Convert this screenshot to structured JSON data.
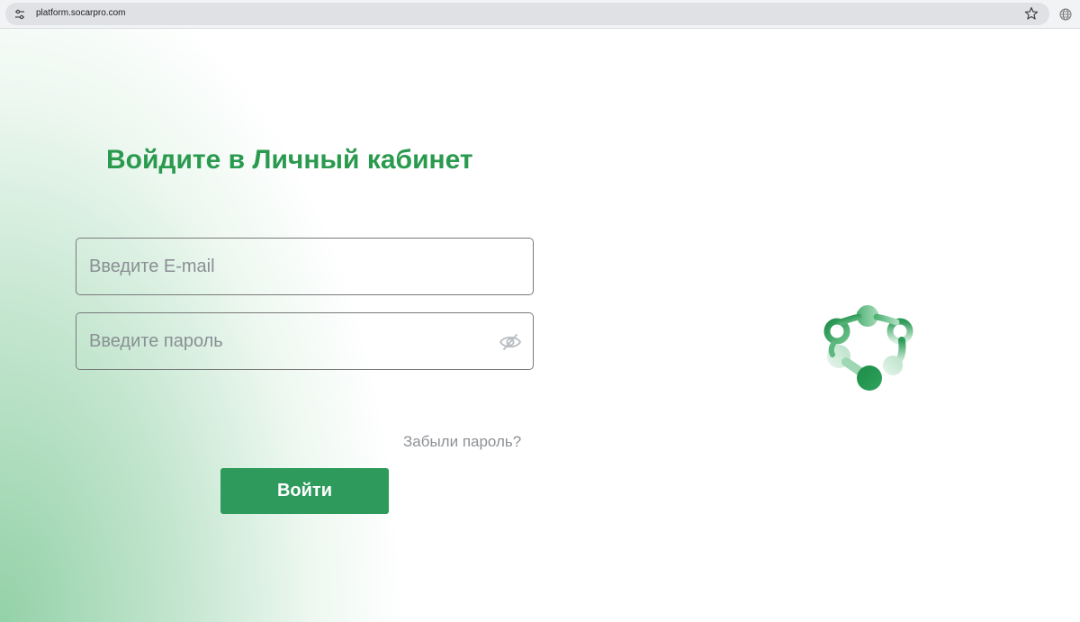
{
  "browser": {
    "url": "platform.socarpro.com"
  },
  "login": {
    "title": "Войдите в Личный кабинет",
    "email_placeholder": "Введите E-mail",
    "password_placeholder": "Введите пароль",
    "forgot_password": "Забыли пароль?",
    "submit_label": "Войти"
  },
  "colors": {
    "accent": "#2a9a4f",
    "button": "#2e9a5c"
  },
  "icons": [
    "site-settings-icon",
    "bookmark-star-icon",
    "globe-icon",
    "eye-slash-icon",
    "brand-logo"
  ]
}
